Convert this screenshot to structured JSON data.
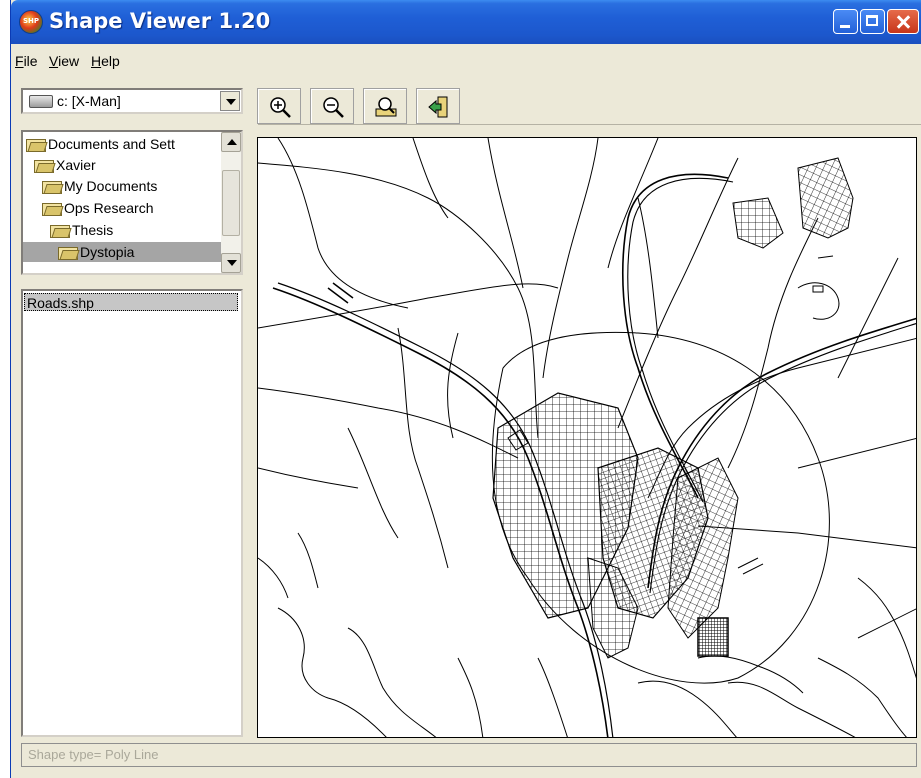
{
  "window": {
    "title": "Shape Viewer 1.20",
    "app_icon_text": "SHP"
  },
  "menu": {
    "items": [
      {
        "accel": "F",
        "rest": "ile"
      },
      {
        "accel": "V",
        "rest": "iew"
      },
      {
        "accel": "H",
        "rest": "elp"
      }
    ]
  },
  "drive": {
    "selected": "c: [X-Man]"
  },
  "folders": [
    {
      "label": "Documents and Sett"
    },
    {
      "label": "Xavier"
    },
    {
      "label": "My Documents"
    },
    {
      "label": "Ops Research"
    },
    {
      "label": "Thesis"
    },
    {
      "label": "Dystopia",
      "selected": true
    }
  ],
  "files": [
    {
      "label": "Roads.shp",
      "selected": true
    }
  ],
  "toolbar": {
    "buttons": [
      {
        "icon": "zoom-in-icon"
      },
      {
        "icon": "zoom-out-icon"
      },
      {
        "icon": "full-extent-icon"
      },
      {
        "icon": "exit-icon"
      }
    ]
  },
  "status": {
    "text": "Shape type= Poly Line"
  },
  "colors": {
    "titlebar": "#1f5fd6",
    "window_bg": "#ece9d8",
    "selection_gray": "#a5a5a5",
    "map_lines": "#000000"
  }
}
